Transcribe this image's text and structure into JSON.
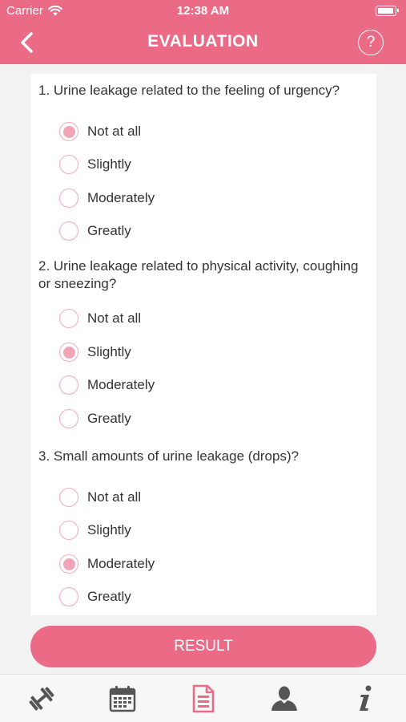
{
  "status_bar": {
    "carrier": "Carrier",
    "time": "12:38 AM"
  },
  "nav": {
    "title": "EVALUATION",
    "help_glyph": "?"
  },
  "questions": [
    {
      "line1": "1. Urine leakage related to the feeling of urgency?",
      "line2": "",
      "selected": 0,
      "options": [
        "Not at all",
        "Slightly",
        "Moderately",
        "Greatly"
      ]
    },
    {
      "line1": "2. Urine leakage related to physical activity, coughing",
      "line2": "or sneezing?",
      "selected": 1,
      "options": [
        "Not at all",
        "Slightly",
        "Moderately",
        "Greatly"
      ]
    },
    {
      "line1": "3. Small amounts of urine leakage (drops)?",
      "line2": "",
      "selected": 2,
      "options": [
        "Not at all",
        "Slightly",
        "Moderately",
        "Greatly"
      ]
    }
  ],
  "result_label": "RESULT",
  "tabs": [
    {
      "icon": "dumbbell-icon",
      "active": false
    },
    {
      "icon": "calendar-icon",
      "active": false
    },
    {
      "icon": "document-icon",
      "active": true
    },
    {
      "icon": "person-icon",
      "active": false
    },
    {
      "icon": "info-icon",
      "active": false
    }
  ],
  "colors": {
    "accent": "#eb6a86",
    "radio_fill": "#f0a4b6",
    "tab_inactive": "#555555"
  }
}
